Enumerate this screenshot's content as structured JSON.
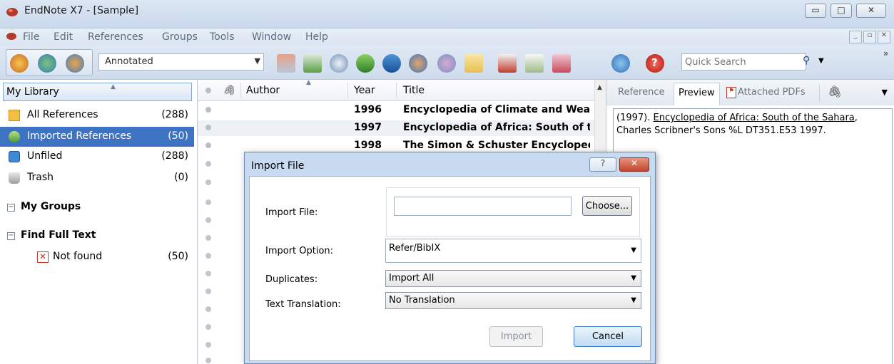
{
  "window": {
    "title": "EndNote X7 - [Sample]",
    "controls": {
      "minimize": "▭",
      "maximize": "□",
      "close": "✕"
    }
  },
  "menu": {
    "items": [
      "File",
      "Edit",
      "References",
      "Groups",
      "Tools",
      "Window",
      "Help"
    ]
  },
  "toolbar": {
    "style_select_value": "Annotated",
    "quick_search_placeholder": "Quick Search",
    "icons": [
      "local-library-mode-icon",
      "online-search-mode-icon",
      "integrated-library-mode-icon",
      "copy-to-library-icon",
      "new-reference-icon",
      "online-search-icon",
      "import-icon",
      "export-icon",
      "find-full-text-icon",
      "open-link-icon",
      "open-file-icon",
      "insert-citation-icon",
      "format-bibliography-icon",
      "return-to-word-icon",
      "sync-icon",
      "help-icon"
    ]
  },
  "left_pane": {
    "header": "My Library",
    "groups": [
      {
        "label": "All References",
        "count": "(288)",
        "icon": "all-references-icon"
      },
      {
        "label": "Imported References",
        "count": "(50)",
        "icon": "imported-references-icon",
        "selected": true
      },
      {
        "label": "Unfiled",
        "count": "(288)",
        "icon": "unfiled-icon"
      },
      {
        "label": "Trash",
        "count": "(0)",
        "icon": "trash-icon"
      }
    ],
    "sections": [
      {
        "label": "My Groups"
      },
      {
        "label": "Find Full Text"
      }
    ],
    "find_full_text_items": [
      {
        "label": "Not found",
        "count": "(50)"
      }
    ]
  },
  "reference_list": {
    "columns": [
      "Author",
      "Year",
      "Title"
    ],
    "rows": [
      {
        "year": "1996",
        "title": "Encyclopedia of Climate and Weath"
      },
      {
        "year": "1997",
        "title": "Encyclopedia of Africa: South of the"
      },
      {
        "year": "1998",
        "title": "The Simon & Schuster Encyclopedia"
      }
    ]
  },
  "right_pane": {
    "tabs": [
      "Reference",
      "Preview",
      "Attached PDFs"
    ],
    "active_tab": "Preview",
    "preview_prefix": "(1997). ",
    "preview_title": "Encyclopedia of Africa: South of the Sahara",
    "preview_rest": ", Charles Scribner's Sons %L DT351.E53 1997."
  },
  "dialog": {
    "title": "Import File",
    "help_label": "?",
    "close_label": "✕",
    "import_file_label": "Import File:",
    "import_file_value": "",
    "choose_label": "Choose...",
    "import_option_label": "Import Option:",
    "import_option_value": "Refer/BibIX",
    "duplicates_label": "Duplicates:",
    "duplicates_value": "Import All",
    "translation_label": "Text Translation:",
    "translation_value": "No Translation",
    "import_button": "Import",
    "cancel_button": "Cancel"
  },
  "colors": {
    "selection": "#3e73c4",
    "dialog_frame": "#c8daf0",
    "close_red": "#c4452d"
  }
}
